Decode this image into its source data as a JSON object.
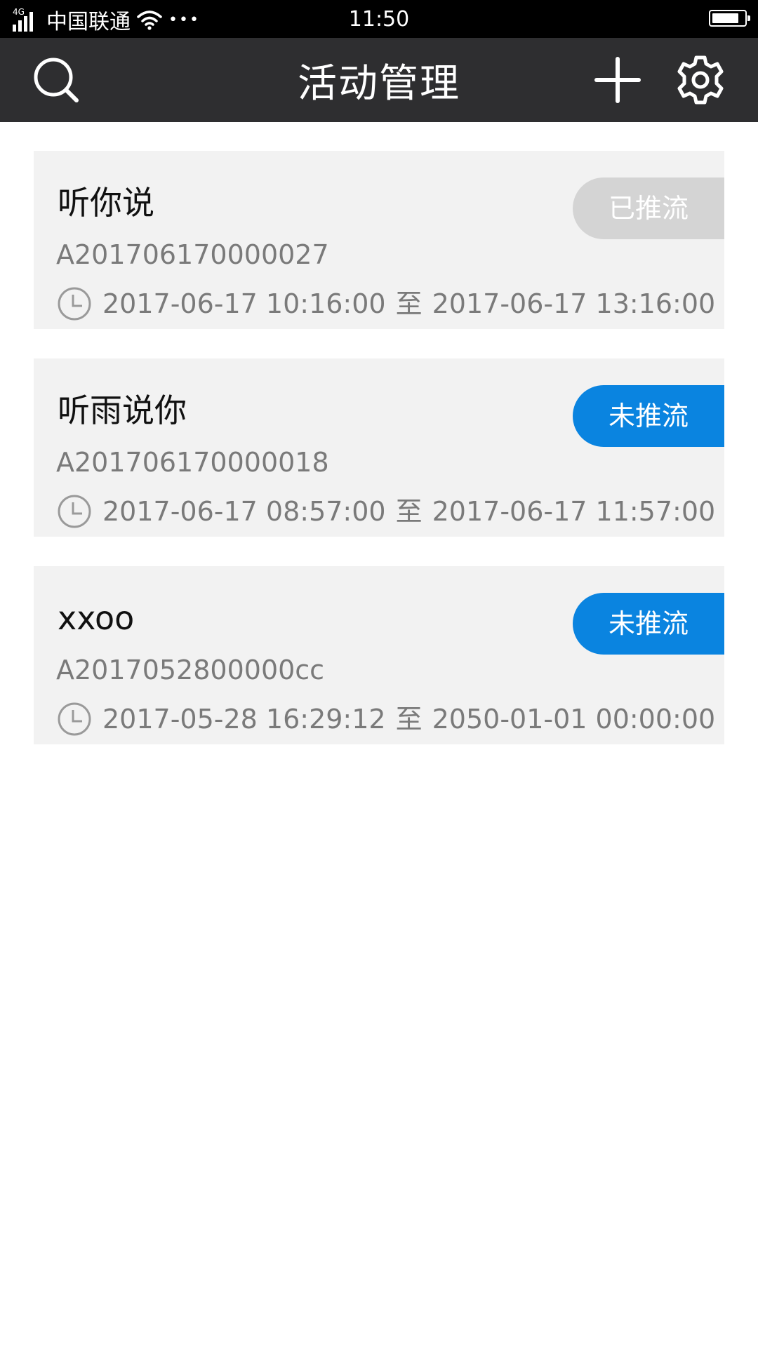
{
  "status_bar": {
    "network": "4G",
    "carrier": "中国联通",
    "dots": "•••",
    "time": "11:50",
    "battery_level": 0.85
  },
  "header": {
    "title": "活动管理",
    "left_icon": "search-icon",
    "right_icons": [
      "plus-icon",
      "gear-icon"
    ]
  },
  "colors": {
    "nav_bg": "#2e2e30",
    "card_bg": "#f2f2f2",
    "pushed": "#d4d4d4",
    "not_pushed": "#0a84e0"
  },
  "activities": [
    {
      "title": "听你说",
      "code": "A201706170000027",
      "start": "2017-06-17 10:16:00",
      "separator": "至",
      "end": "2017-06-17 13:16:00",
      "status": "已推流",
      "status_color": "#d4d4d4"
    },
    {
      "title": "听雨说你",
      "code": "A201706170000018",
      "start": "2017-06-17 08:57:00",
      "separator": "至",
      "end": "2017-06-17 11:57:00",
      "status": "未推流",
      "status_color": "#0a84e0"
    },
    {
      "title": "xxoo",
      "code": "A2017052800000cc",
      "start": "2017-05-28 16:29:12",
      "separator": "至",
      "end": "2050-01-01 00:00:00",
      "status": "未推流",
      "status_color": "#0a84e0"
    }
  ]
}
